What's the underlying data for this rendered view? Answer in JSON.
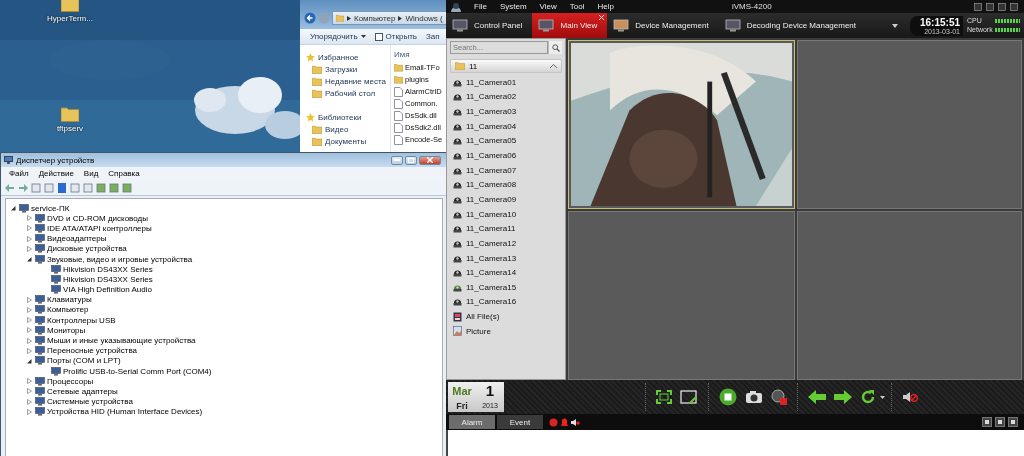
{
  "desktop": {
    "icons": [
      {
        "label": "HyperTerm..."
      },
      {
        "label": "tftpserv"
      }
    ]
  },
  "explorer": {
    "address": [
      "Компьютер",
      "Windows ("
    ],
    "toolbar": [
      {
        "label": "Упорядочить",
        "kind": "menu"
      },
      {
        "label": "Открыть",
        "kind": "open"
      },
      {
        "label": "Зап",
        "kind": "plain"
      }
    ],
    "nav": [
      {
        "label": "Избранное",
        "kind": "header"
      },
      {
        "label": "Загрузки",
        "kind": "item"
      },
      {
        "label": "Недавние места",
        "kind": "item"
      },
      {
        "label": "Рабочий стол",
        "kind": "item"
      },
      {
        "label": "Библиотеки",
        "kind": "header"
      },
      {
        "label": "Видео",
        "kind": "item"
      },
      {
        "label": "Документы",
        "kind": "item"
      }
    ],
    "column_header": "Имя",
    "files": [
      {
        "name": "Email-TFo",
        "kind": "folder"
      },
      {
        "name": "plugins",
        "kind": "folder"
      },
      {
        "name": "AlarmCtrlD",
        "kind": "file"
      },
      {
        "name": "Common.",
        "kind": "file"
      },
      {
        "name": "DsSdk.dll",
        "kind": "file"
      },
      {
        "name": "DsSdk2.dll",
        "kind": "file"
      },
      {
        "name": "Encode-Se",
        "kind": "file"
      }
    ]
  },
  "device_manager": {
    "title": "Диспетчер устройств",
    "menu": [
      "Файл",
      "Действие",
      "Вид",
      "Справка"
    ],
    "tree": {
      "label": "service-ПК",
      "expanded": true,
      "children": [
        {
          "label": "DVD и CD-ROM дисководы",
          "expanded": false
        },
        {
          "label": "IDE ATA/ATAPI контроллеры",
          "expanded": false
        },
        {
          "label": "Видеоадаптеры",
          "expanded": false
        },
        {
          "label": "Дисковые устройства",
          "expanded": false
        },
        {
          "label": "Звуковые, видео и игровые устройства",
          "expanded": true,
          "children": [
            {
              "label": "Hikvision DS43XX Series"
            },
            {
              "label": "Hikvision DS43XX Series"
            },
            {
              "label": "VIA High Definition Audio"
            }
          ]
        },
        {
          "label": "Клавиатуры",
          "expanded": false
        },
        {
          "label": "Компьютер",
          "expanded": false
        },
        {
          "label": "Контроллеры USB",
          "expanded": false
        },
        {
          "label": "Мониторы",
          "expanded": false
        },
        {
          "label": "Мыши и иные указывающие устройства",
          "expanded": false
        },
        {
          "label": "Переносные устройства",
          "expanded": false
        },
        {
          "label": "Порты (COM и LPT)",
          "expanded": true,
          "children": [
            {
              "label": "Prolific USB-to-Serial Comm Port (COM4)"
            }
          ]
        },
        {
          "label": "Процессоры",
          "expanded": false
        },
        {
          "label": "Сетевые адаптеры",
          "expanded": false
        },
        {
          "label": "Системные устройства",
          "expanded": false
        },
        {
          "label": "Устройства HID (Human Interface Devices)",
          "expanded": false
        }
      ]
    }
  },
  "ivms": {
    "title": "iVMS-4200",
    "menu": [
      "File",
      "System",
      "View",
      "Tool",
      "Help"
    ],
    "tabs": [
      {
        "label": "Control Panel",
        "selected": false,
        "closable": false
      },
      {
        "label": "Main View",
        "selected": true,
        "closable": true
      },
      {
        "label": "Device Management",
        "selected": false,
        "closable": false
      },
      {
        "label": "Decoding Device Management",
        "selected": false,
        "closable": false
      }
    ],
    "clock": {
      "time": "16:15:51",
      "date": "2013-03-01"
    },
    "meters": [
      {
        "label": "CPU",
        "level": 1
      },
      {
        "label": "Network",
        "level": 1
      }
    ],
    "search": {
      "placeholder": "Search..."
    },
    "group": {
      "label": "11",
      "expanded": true
    },
    "resources": [
      {
        "label": "11_Camera01",
        "kind": "camera",
        "playing": false
      },
      {
        "label": "11_Camera02",
        "kind": "camera",
        "playing": false
      },
      {
        "label": "11_Camera03",
        "kind": "camera",
        "playing": false
      },
      {
        "label": "11_Camera04",
        "kind": "camera",
        "playing": false
      },
      {
        "label": "11_Camera05",
        "kind": "camera",
        "playing": false
      },
      {
        "label": "11_Camera06",
        "kind": "camera",
        "playing": false
      },
      {
        "label": "11_Camera07",
        "kind": "camera",
        "playing": false
      },
      {
        "label": "11_Camera08",
        "kind": "camera",
        "playing": false
      },
      {
        "label": "11_Camera09",
        "kind": "camera",
        "playing": false
      },
      {
        "label": "11_Camera10",
        "kind": "camera",
        "playing": false
      },
      {
        "label": "11_Camera11",
        "kind": "camera",
        "playing": false
      },
      {
        "label": "11_Camera12",
        "kind": "camera",
        "playing": false
      },
      {
        "label": "11_Camera13",
        "kind": "camera",
        "playing": false
      },
      {
        "label": "11_Camera14",
        "kind": "camera",
        "playing": false
      },
      {
        "label": "11_Camera15",
        "kind": "camera",
        "playing": true
      },
      {
        "label": "11_Camera16",
        "kind": "camera",
        "playing": false
      },
      {
        "label": "All File(s)",
        "kind": "files"
      },
      {
        "label": "Picture",
        "kind": "picture"
      }
    ],
    "views": [
      {
        "kind": "video",
        "selected": true
      },
      {
        "kind": "empty",
        "selected": false
      },
      {
        "kind": "empty",
        "selected": false
      },
      {
        "kind": "empty",
        "selected": false
      }
    ],
    "calendar": {
      "month": "Mar",
      "day": "1",
      "weekday": "Fri",
      "year": "2013"
    },
    "alarm_tabs": [
      {
        "label": "Alarm",
        "selected": true
      },
      {
        "label": "Event",
        "selected": false
      }
    ]
  }
}
